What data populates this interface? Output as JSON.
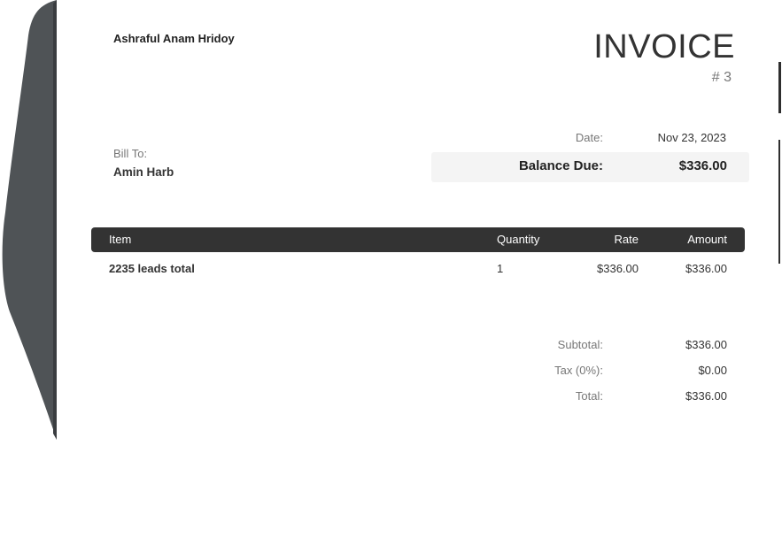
{
  "sender": "Ashraful Anam Hridoy",
  "invoice": {
    "title": "INVOICE",
    "number": "# 3"
  },
  "bill_to": {
    "label": "Bill To:",
    "name": "Amin Harb"
  },
  "date": {
    "label": "Date:",
    "value": "Nov 23, 2023"
  },
  "balance_due": {
    "label": "Balance Due:",
    "value": "$336.00"
  },
  "table": {
    "headers": {
      "item": "Item",
      "quantity": "Quantity",
      "rate": "Rate",
      "amount": "Amount"
    },
    "rows": [
      {
        "item": "2235 leads total",
        "quantity": "1",
        "rate": "$336.00",
        "amount": "$336.00"
      }
    ]
  },
  "summary": {
    "subtotal_label": "Subtotal:",
    "subtotal_value": "$336.00",
    "tax_label": "Tax (0%):",
    "tax_value": "$0.00",
    "total_label": "Total:",
    "total_value": "$336.00"
  },
  "colors": {
    "header_bar": "#333333",
    "balance_box": "#f4f4f4",
    "muted_text": "#777777",
    "page_curl": "#4f5356"
  }
}
